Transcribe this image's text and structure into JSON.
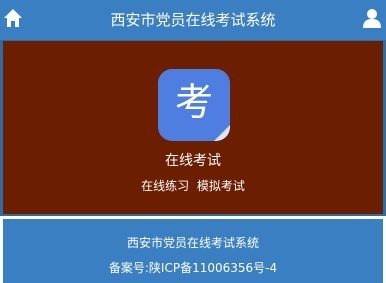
{
  "header": {
    "title": "西安市党员在线考试系统",
    "left_icon": "home-icon",
    "right_icon": "user-icon"
  },
  "hero": {
    "app_icon_glyph": "考",
    "app_name": "在线考试",
    "link_practice": "在线练习",
    "link_mock": "模拟考试"
  },
  "footer": {
    "title": "西安市党员在线考试系统",
    "record": "备案号:陕ICP备11006356号-4"
  },
  "colors": {
    "header_bg": "#3a7fc1",
    "hero_bg": "#6b1e00",
    "hero_border": "#2e6da4",
    "app_icon_bg": "#4e7fe0",
    "text": "#ffffff"
  }
}
